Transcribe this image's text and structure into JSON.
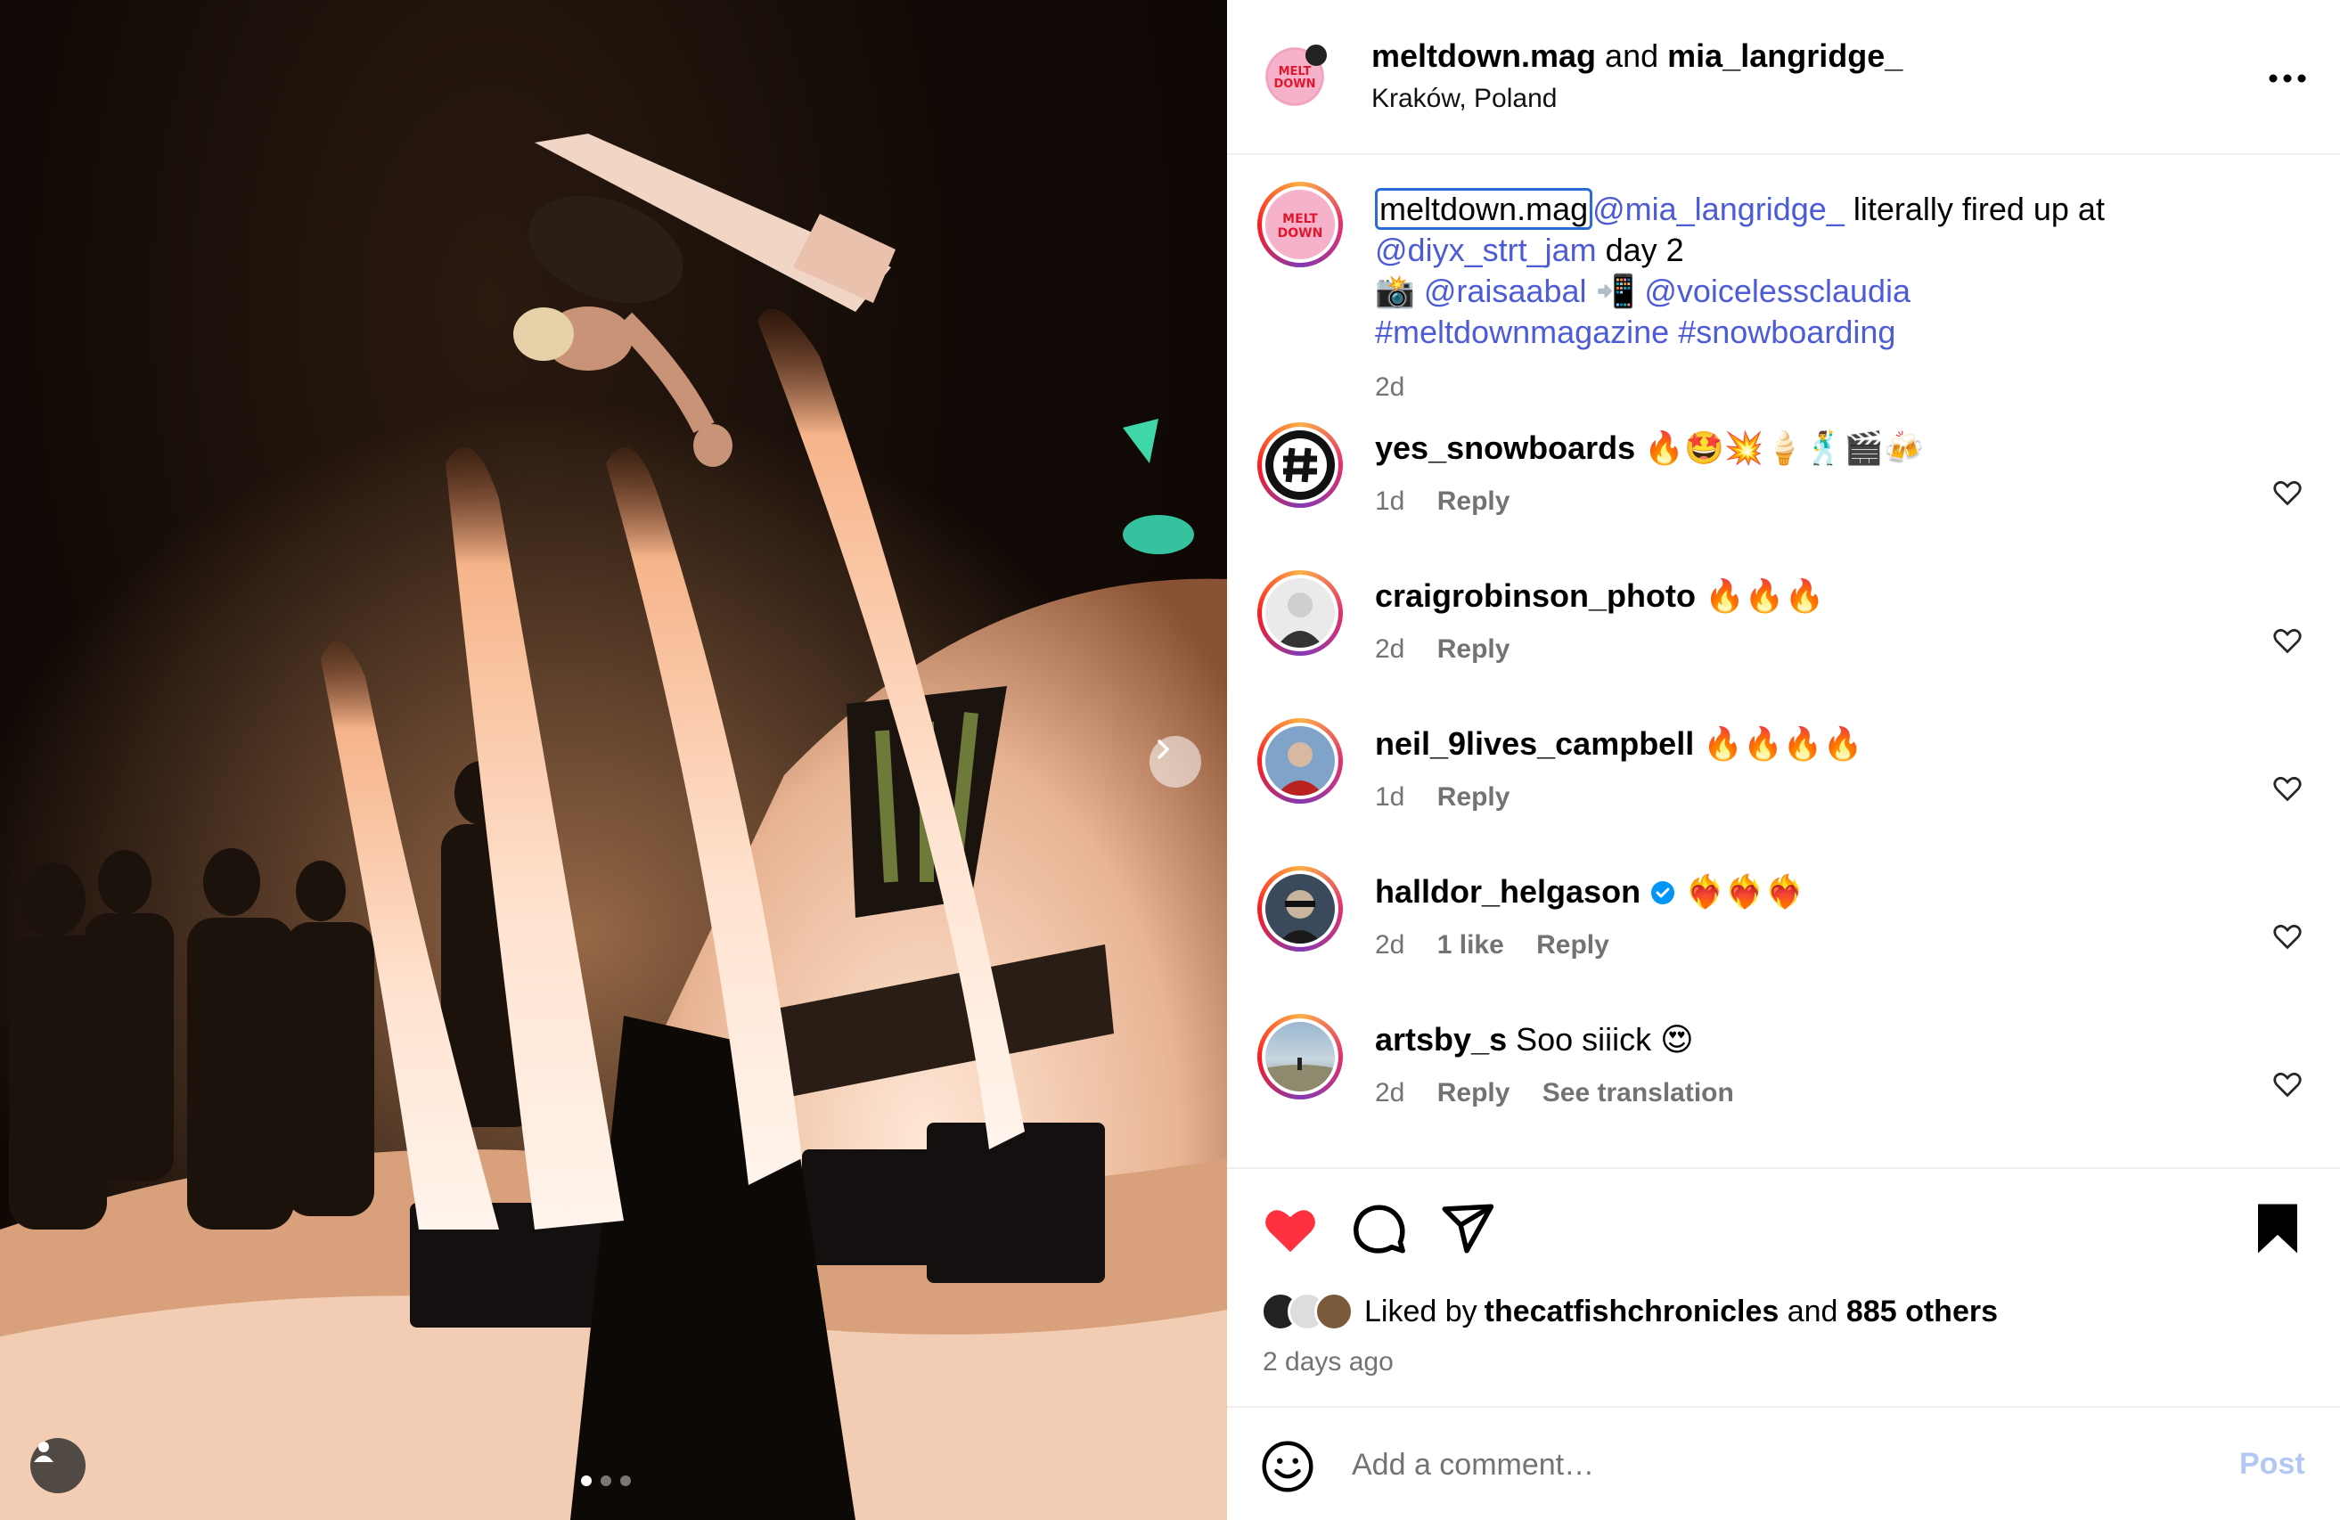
{
  "post": {
    "author": "meltdown.mag",
    "joiner": "and",
    "coauthor": "mia_langridge_",
    "location": "Kraków, Poland",
    "avatar_text": "MELT DOWN"
  },
  "caption": {
    "handle": "meltdown.mag",
    "mention1": "@mia_langridge_",
    "text1": " literally fired up at",
    "mention2": "@diyx_strt_jam",
    "text2": " day 2",
    "camera_emoji": "📸",
    "mention3": "@raisaabal",
    "phone_emoji": "📲",
    "mention4": "@voicelessclaudia",
    "hashtag1": "#meltdownmagazine",
    "hashtag2": "#snowboarding",
    "time": "2d"
  },
  "comments": [
    {
      "user": "yes_snowboards",
      "text": "🔥🤩💥🍦🕺🎬🍻",
      "time": "1d",
      "likes": "",
      "reply": "Reply",
      "extra": ""
    },
    {
      "user": "craigrobinson_photo",
      "text": "🔥🔥🔥",
      "time": "2d",
      "likes": "",
      "reply": "Reply",
      "extra": ""
    },
    {
      "user": "neil_9lives_campbell",
      "text": "🔥🔥🔥🔥",
      "time": "1d",
      "likes": "",
      "reply": "Reply",
      "extra": ""
    },
    {
      "user": "halldor_helgason",
      "text": "❤️‍🔥❤️‍🔥❤️‍🔥",
      "time": "2d",
      "likes": "1 like",
      "reply": "Reply",
      "extra": "",
      "verified": true
    },
    {
      "user": "artsby_s",
      "text": "Soo siiick 😍",
      "time": "2d",
      "likes": "",
      "reply": "Reply",
      "extra": "See translation"
    }
  ],
  "likes": {
    "prefix": "Liked by ",
    "user": "thecatfishchronicles",
    "joiner": " and ",
    "others": "885 others",
    "ago": "2 days ago"
  },
  "composer": {
    "placeholder": "Add a comment…",
    "post_label": "Post"
  },
  "colors": {
    "accent_link": "#4d5bd6",
    "like_red": "#ff3040",
    "post_disabled": "#b3c7f5",
    "verified_blue": "#0095f6"
  },
  "icons": [
    "more-options-icon",
    "heart-icon",
    "comment-icon",
    "share-icon",
    "bookmark-icon",
    "emoji-icon",
    "chevron-right-icon",
    "tagged-user-icon"
  ]
}
